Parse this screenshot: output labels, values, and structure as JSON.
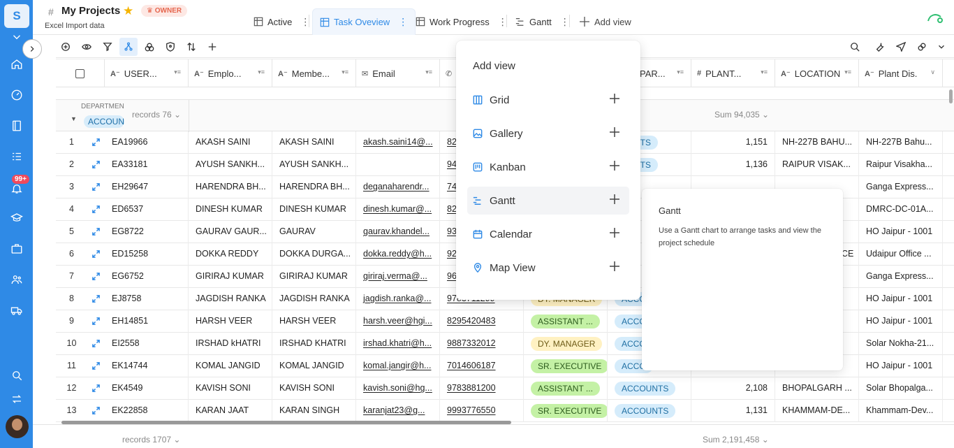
{
  "sidebar": {
    "logo_letter": "S",
    "notification_badge": "99+"
  },
  "header": {
    "hash": "#",
    "title": "My Projects",
    "owner_badge": "OWNER",
    "subtitle": "Excel Import data"
  },
  "tabs": [
    {
      "label": "Active",
      "icon": "grid-icon"
    },
    {
      "label": "Task Oveview",
      "icon": "grid-icon",
      "active": true
    },
    {
      "label": "Work Progress",
      "icon": "grid-icon"
    },
    {
      "label": "Gantt",
      "icon": "gantt-icon"
    }
  ],
  "add_view_label": "Add view",
  "columns": [
    {
      "label": "USER..."
    },
    {
      "label": "Emplo..."
    },
    {
      "label": "Membe..."
    },
    {
      "label": "Email"
    },
    {
      "label": "PAR..."
    },
    {
      "label": "PLANT..."
    },
    {
      "label": "LOCATION"
    },
    {
      "label": "Plant Dis."
    }
  ],
  "group": {
    "field": "DEPARTMEN",
    "value": "ACCOUN",
    "records": "records 76",
    "sum": "Sum 94,035"
  },
  "rows": [
    {
      "n": "1",
      "user": "EA19966",
      "emp": "AKASH SAINI",
      "member": "AKASH SAINI",
      "email": "akash.saini14@...",
      "phone": "82",
      "desig": "",
      "dept": "OUNTS",
      "plant": "1,151",
      "location": "NH-227B BAHU...",
      "plantdis": "NH-227B Bahu..."
    },
    {
      "n": "2",
      "user": "EA33181",
      "emp": "AYUSH SANKH...",
      "member": "AYUSH SANKH...",
      "email": "",
      "phone": "94",
      "desig": "",
      "dept": "OUNTS",
      "plant": "1,136",
      "location": "RAIPUR VISAK...",
      "plantdis": "Raipur Visakha..."
    },
    {
      "n": "3",
      "user": "EH29647",
      "emp": "HARENDRA BH...",
      "member": "HARENDRA BH...",
      "email": "deganaharendr...",
      "phone": "74",
      "desig": "",
      "dept": "",
      "plant": "",
      "location": "",
      "plantdis": "Ganga Express..."
    },
    {
      "n": "4",
      "user": "ED6537",
      "emp": "DINESH KUMAR",
      "member": "DINESH KUMAR",
      "email": "dinesh.kumar@...",
      "phone": "82",
      "desig": "",
      "dept": "",
      "plant": "",
      "location": "",
      "plantdis": "DMRC-DC-01A..."
    },
    {
      "n": "5",
      "user": "EG8722",
      "emp": "GAURAV GAUR...",
      "member": "GAURAV",
      "email": "gaurav.khandel...",
      "phone": "93",
      "desig": "",
      "dept": "",
      "plant": "",
      "location": "",
      "plantdis": "HO Jaipur - 1001"
    },
    {
      "n": "6",
      "user": "ED15258",
      "emp": "DOKKA REDDY",
      "member": "DOKKA DURGA...",
      "email": "dokka.reddy@h...",
      "phone": "92",
      "desig": "",
      "dept": "",
      "plant": "",
      "location": "",
      "plantdis": "Udaipur Office ..."
    },
    {
      "n": "7",
      "user": "EG6752",
      "emp": "GIRIRAJ KUMAR",
      "member": "GIRIRAJ KUMAR",
      "email": "giriraj.verma@...",
      "phone": "96",
      "desig": "",
      "dept": "",
      "plant": "",
      "location": "",
      "plantdis": "Ganga Express..."
    },
    {
      "n": "8",
      "user": "EJ8758",
      "emp": "JAGDISH RANKA",
      "member": "JAGDISH RANKA",
      "email": "jagdish.ranka@...",
      "phone": "9783711299",
      "desig": "DY. MANAGER",
      "dept": "ACCO",
      "plant": "",
      "location": "",
      "plantdis": "HO Jaipur - 1001"
    },
    {
      "n": "9",
      "user": "EH14851",
      "emp": "HARSH VEER",
      "member": "HARSH VEER",
      "email": "harsh.veer@hgi...",
      "phone": "8295420483",
      "desig": "ASSISTANT ...",
      "dept": "ACCO",
      "plant": "",
      "location": "",
      "plantdis": "HO Jaipur - 1001"
    },
    {
      "n": "10",
      "user": "EI2558",
      "emp": "IRSHAD kHATRI",
      "member": "IRSHAD KHATRI",
      "email": "irshad.khatri@h...",
      "phone": "9887332012",
      "desig": "DY. MANAGER",
      "dept": "ACCO",
      "plant": "",
      "location": "",
      "plantdis": "Solar Nokha-21..."
    },
    {
      "n": "11",
      "user": "EK14744",
      "emp": "KOMAL JANGID",
      "member": "KOMAL JANGID",
      "email": "komal.jangir@h...",
      "phone": "7014606187",
      "desig": "SR. EXECUTIVE",
      "dept": "ACCO",
      "plant": "",
      "location": "",
      "plantdis": "HO Jaipur - 1001"
    },
    {
      "n": "12",
      "user": "EK4549",
      "emp": "KAVISH SONI",
      "member": "KAVISH SONI",
      "email": "kavish.soni@hg...",
      "phone": "9783881200",
      "desig": "ASSISTANT ...",
      "dept": "ACCOUNTS",
      "plant": "2,108",
      "location": "BHOPALGARH ...",
      "plantdis": "Solar Bhopalga..."
    },
    {
      "n": "13",
      "user": "EK22858",
      "emp": "KARAN JAAT",
      "member": "KARAN SINGH",
      "email": "karanjat23@g...",
      "phone": "9993776550",
      "desig": "SR. EXECUTIVE",
      "dept": "ACCOUNTS",
      "plant": "1,131",
      "location": "KHAMMAM-DE...",
      "plantdis": "Khammam-Dev..."
    }
  ],
  "row6_location_fragment": "CE",
  "footer": {
    "records": "records 1707",
    "sum": "Sum 2,191,458"
  },
  "add_view_menu": {
    "title": "Add view",
    "items": [
      {
        "label": "Grid",
        "icon": "grid-icon"
      },
      {
        "label": "Gallery",
        "icon": "gallery-icon"
      },
      {
        "label": "Kanban",
        "icon": "kanban-icon"
      },
      {
        "label": "Gantt",
        "icon": "gantt-icon",
        "hovered": true
      },
      {
        "label": "Calendar",
        "icon": "calendar-icon"
      },
      {
        "label": "Map View",
        "icon": "map-pin-icon"
      }
    ]
  },
  "tooltip": {
    "title": "Gantt",
    "body": "Use a Gantt chart to arrange tasks and view the project schedule"
  },
  "colors": {
    "brand": "#2f8ae6",
    "green_pill": "#c4f1a5",
    "yellow_pill": "#fff1c2",
    "blue_pill": "#d5ecfb",
    "owner_badge": "#e5654d"
  }
}
